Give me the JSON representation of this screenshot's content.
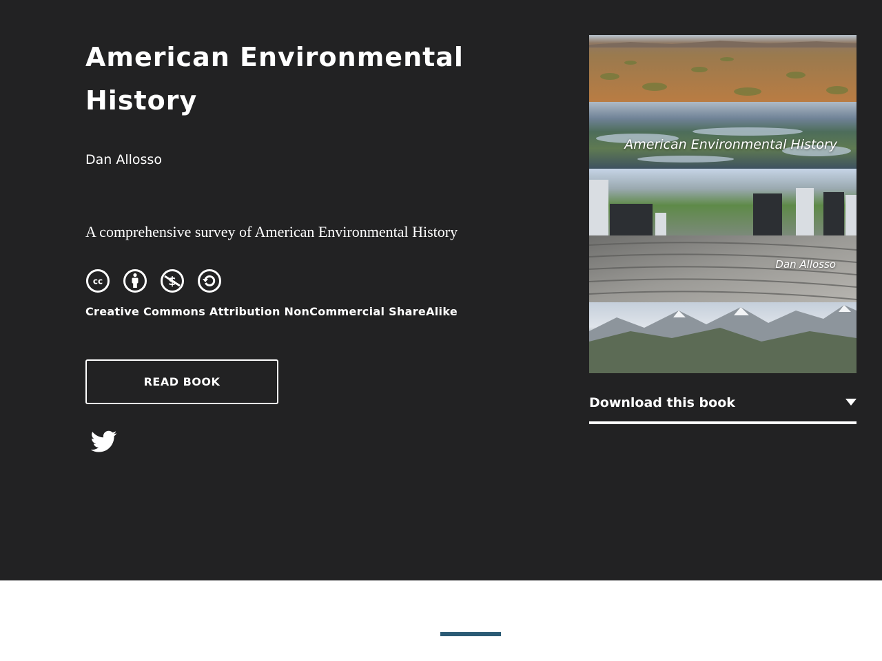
{
  "book": {
    "title": "American Environmental History",
    "author": "Dan Allosso",
    "about": "A comprehensive survey of American Environmental History",
    "license": {
      "name": "Creative Commons Attribution NonCommercial ShareAlike",
      "icons": [
        "cc-icon",
        "attribution-icon",
        "noncommercial-icon",
        "sharealike-icon"
      ]
    },
    "read_button_label": "READ BOOK",
    "share_icon": "twitter-icon"
  },
  "cover": {
    "title_text": "American Environmental History",
    "author_text": "Dan Allosso"
  },
  "download": {
    "label": "Download this book"
  },
  "colors": {
    "hero_background": "#222223",
    "page_background": "#ffffff",
    "accent": "#2a5a74",
    "text": "#ffffff"
  }
}
